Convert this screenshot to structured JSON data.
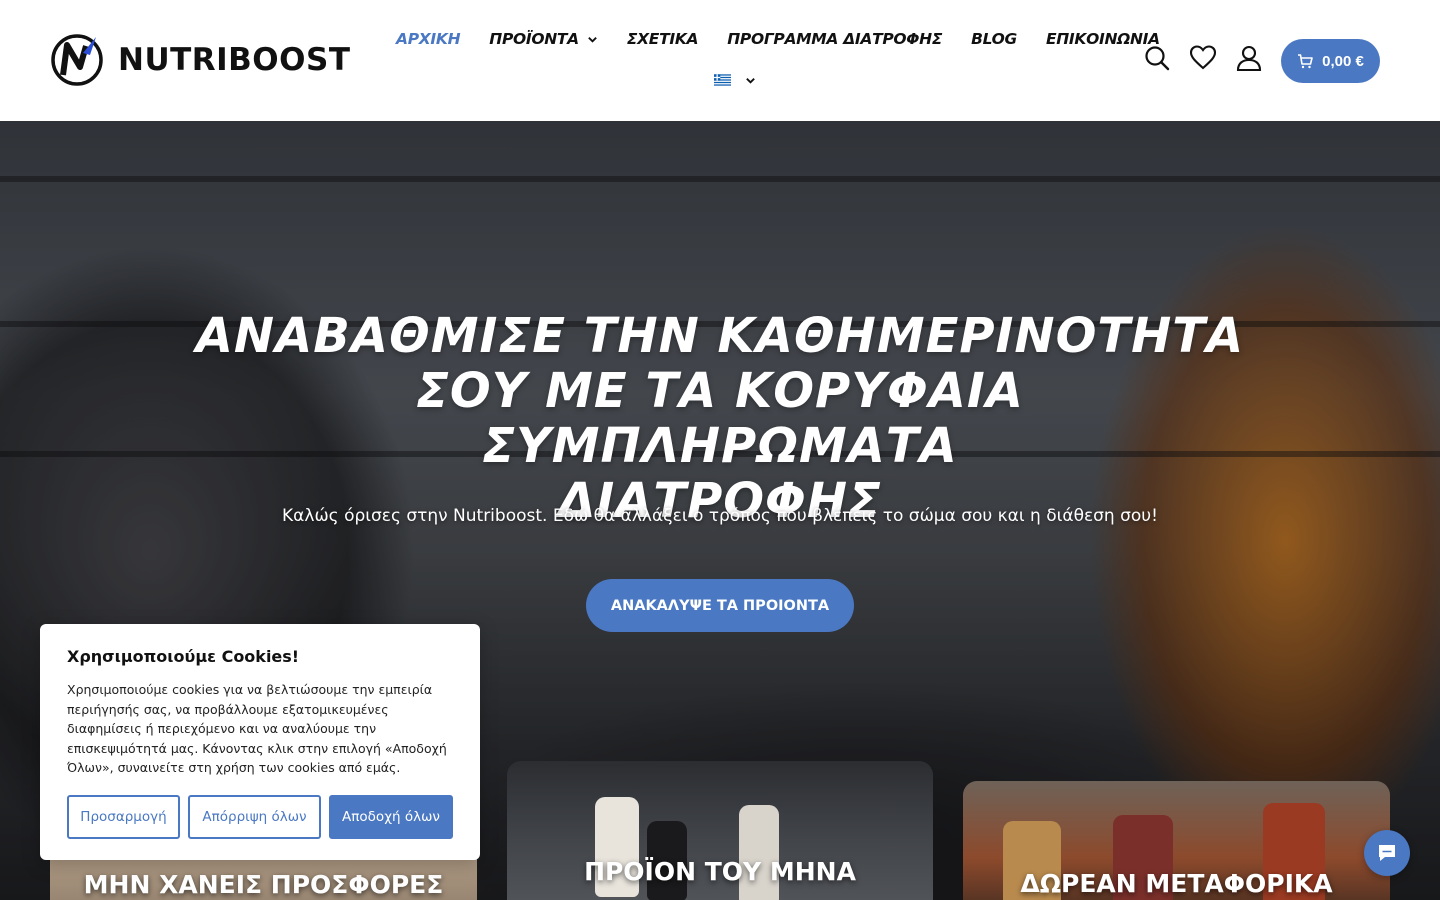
{
  "brand": {
    "name": "NUTRIBOOST"
  },
  "nav": {
    "items": [
      {
        "label": "ΑΡΧΙΚΗ",
        "active": true
      },
      {
        "label": "ΠΡΟΪΟΝΤΑ",
        "dropdown": true
      },
      {
        "label": "ΣΧΕΤΙΚΑ"
      },
      {
        "label": "ΠΡΟΓΡΑΜΜΑ ΔΙΑΤΡΟΦΗΣ"
      },
      {
        "label": "BLOG"
      },
      {
        "label": "ΕΠΙΚΟΙΝΩΝΙΑ"
      }
    ],
    "language": {
      "flag": "greek-flag-icon"
    }
  },
  "header": {
    "icons": [
      "search-icon",
      "heart-icon",
      "user-icon"
    ],
    "cart_total": "0,00 €"
  },
  "hero": {
    "title_lines": [
      "ΑΝΑΒΑΘΜΙΣΕ ΤΗΝ ΚΑΘΗΜΕΡΙΝΟΤΗΤΑ",
      "ΣΟΥ ΜΕ ΤΑ ΚΟΡΥΦΑΙΑ ΣΥΜΠΛΗΡΩΜΑΤΑ",
      "ΔΙΑΤΡΟΦΗΣ"
    ],
    "subtitle": "Καλώς όρισες στην Nutriboost. Εδώ θα αλλάξει ο τρόπος που βλέπεις το σώμα σου και η διάθεση σου!",
    "cta_label": "ΑΝΑΚΑΛΥΨΕ ΤΑ ΠΡΟΙΟΝΤΑ"
  },
  "cards": [
    {
      "label": "ΜΗΝ ΧΑΝΕΙΣ ΠΡΟΣΦΟΡΕΣ"
    },
    {
      "label": "ΠΡΟΪΟΝ ΤΟΥ ΜΗΝΑ"
    },
    {
      "label": "ΔΩΡΕΑΝ ΜΕΤΑΦΟΡΙΚΑ"
    }
  ],
  "cookie": {
    "title": "Χρησιμοποιούμε Cookies!",
    "text": "Χρησιμοποιούμε cookies για να βελτιώσουμε την εμπειρία περιήγησής σας, να προβάλλουμε εξατομικευμένες διαφημίσεις ή περιεχόμενο και να αναλύουμε την επισκεψιμότητά μας. Κάνοντας κλικ στην επιλογή «Αποδοχή Όλων», συναινείτε στη χρήση των cookies από εμάς.",
    "customize_label": "Προσαρμογή",
    "reject_label": "Απόρριψη όλων",
    "accept_label": "Αποδοχή όλων"
  },
  "chat": {
    "icon": "chat-bubble-icon"
  },
  "colors": {
    "accent": "#4a78c2",
    "text": "#111111"
  }
}
